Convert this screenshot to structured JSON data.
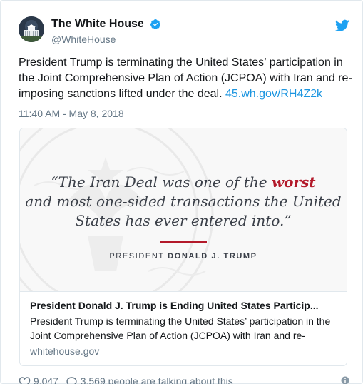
{
  "account": {
    "display_name": "The White House",
    "handle": "@WhiteHouse",
    "verified": true,
    "avatar_icon": "white-house-avatar-icon"
  },
  "tweet": {
    "text": "President Trump is terminating the United States’ participation in the Joint Comprehensive Plan of Action (JCPOA) with Iran and re-imposing sanctions lifted under the deal. ",
    "link": "45.wh.gov/RH4Z2k",
    "timestamp": "11:40 AM - May 8, 2018"
  },
  "card": {
    "quote_part1": "“The Iran Deal was one of the ",
    "quote_emph": "worst",
    "quote_part2": " and most one-sided transactions the United States has ever entered into.”",
    "attribution_prefix": "PRESIDENT ",
    "attribution_name": "DONALD J. TRUMP",
    "title": "President Donald J. Trump is Ending United States Particip...",
    "description": "President Trump is terminating the United States’ participation in the Joint Comprehensive Plan of Action (JCPOA) with Iran and re-",
    "domain": "whitehouse.gov"
  },
  "actions": {
    "likes": "9,047",
    "talking": "3,569 people are talking about this"
  },
  "colors": {
    "link": "#1b95e0",
    "accent_red": "#b3192a",
    "muted": "#657786",
    "verified_blue": "#1da1f2"
  }
}
